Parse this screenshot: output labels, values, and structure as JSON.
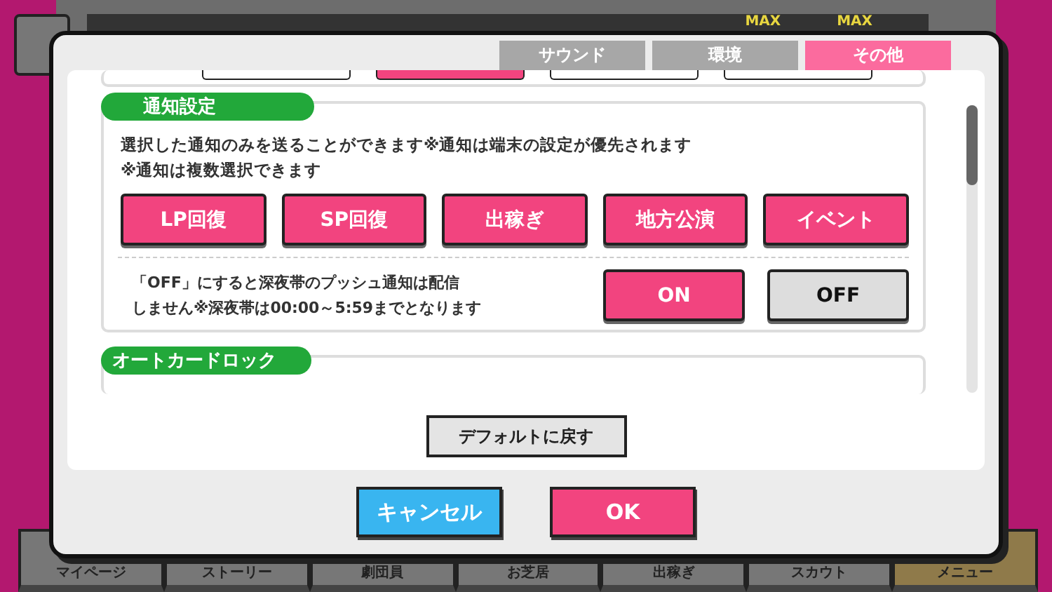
{
  "header": {
    "lp_badge": "MAX",
    "sp_badge": "MAX"
  },
  "tabs": [
    {
      "label": "サウンド",
      "selected": false
    },
    {
      "label": "環境",
      "selected": false
    },
    {
      "label": "その他",
      "selected": true
    }
  ],
  "partial_buttons": [
    {
      "selected": false
    },
    {
      "selected": true
    },
    {
      "selected": false
    },
    {
      "selected": false
    }
  ],
  "notification": {
    "title": "通知設定",
    "description": [
      "選択した通知のみを送ることができます※通知は端末の設定が優先されます",
      "※通知は複数選択できます"
    ],
    "options": [
      {
        "label": "LP回復",
        "selected": true
      },
      {
        "label": "SP回復",
        "selected": true
      },
      {
        "label": "出稼ぎ",
        "selected": true
      },
      {
        "label": "地方公演",
        "selected": true
      },
      {
        "label": "イベント",
        "selected": true
      }
    ],
    "night_note": [
      "「OFF」にすると深夜帯のプッシュ通知は配信",
      "しません※深夜帯は00:00～5:59までとなります"
    ],
    "night_choices": [
      {
        "label": "ON",
        "selected": true
      },
      {
        "label": "OFF",
        "selected": false
      }
    ]
  },
  "auto_card_lock": {
    "title": "オートカードロック"
  },
  "reset_button": "デフォルトに戻す",
  "cancel_button": "キャンセル",
  "ok_button": "OK",
  "bottom_nav": [
    {
      "label": "マイページ",
      "selected": false
    },
    {
      "label": "ストーリー",
      "selected": false
    },
    {
      "label": "劇団員",
      "selected": false
    },
    {
      "label": "お芝居",
      "selected": false
    },
    {
      "label": "出稼ぎ",
      "selected": false
    },
    {
      "label": "スカウト",
      "selected": false
    },
    {
      "label": "メニュー",
      "selected": true
    }
  ]
}
